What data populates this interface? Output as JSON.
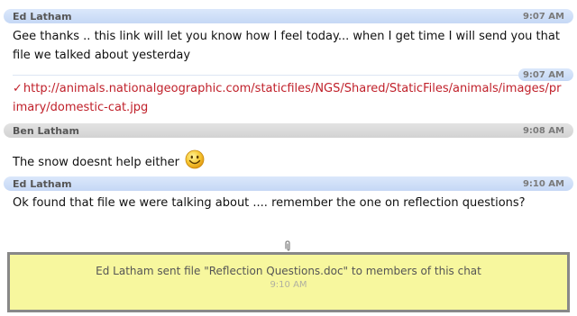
{
  "messages": [
    {
      "sender": "Ed Latham",
      "time": "9:07 AM",
      "text": "Gee thanks .. this link will let you know how I feel today... when I get time I will send you that file we talked about yesterday",
      "continuation_time": "9:07 AM",
      "link_mark": "✓",
      "link": "http://animals.nationalgeographic.com/staticfiles/NGS/Shared/StaticFiles/animals/images/primary/domestic-cat.jpg",
      "header_style": "blue"
    },
    {
      "sender": "Ben Latham",
      "time": "9:08 AM",
      "text": "The snow doesnt help either",
      "emoticon": "smiley-face-icon",
      "header_style": "gray"
    },
    {
      "sender": "Ed Latham",
      "time": "9:10 AM",
      "text": "Ok found that file we were talking about .... remember the one on reflection questions?",
      "header_style": "blue"
    }
  ],
  "file_notice": {
    "text": "Ed Latham sent file \"Reflection Questions.doc\" to members of this chat",
    "time": "9:10 AM",
    "icon": "paperclip-icon"
  },
  "colors": {
    "blue_header": "#c5d8f5",
    "gray_header": "#d2d2d2",
    "link": "#c0202a",
    "notice_background": "#f7f79e",
    "notice_border": "#888888"
  }
}
